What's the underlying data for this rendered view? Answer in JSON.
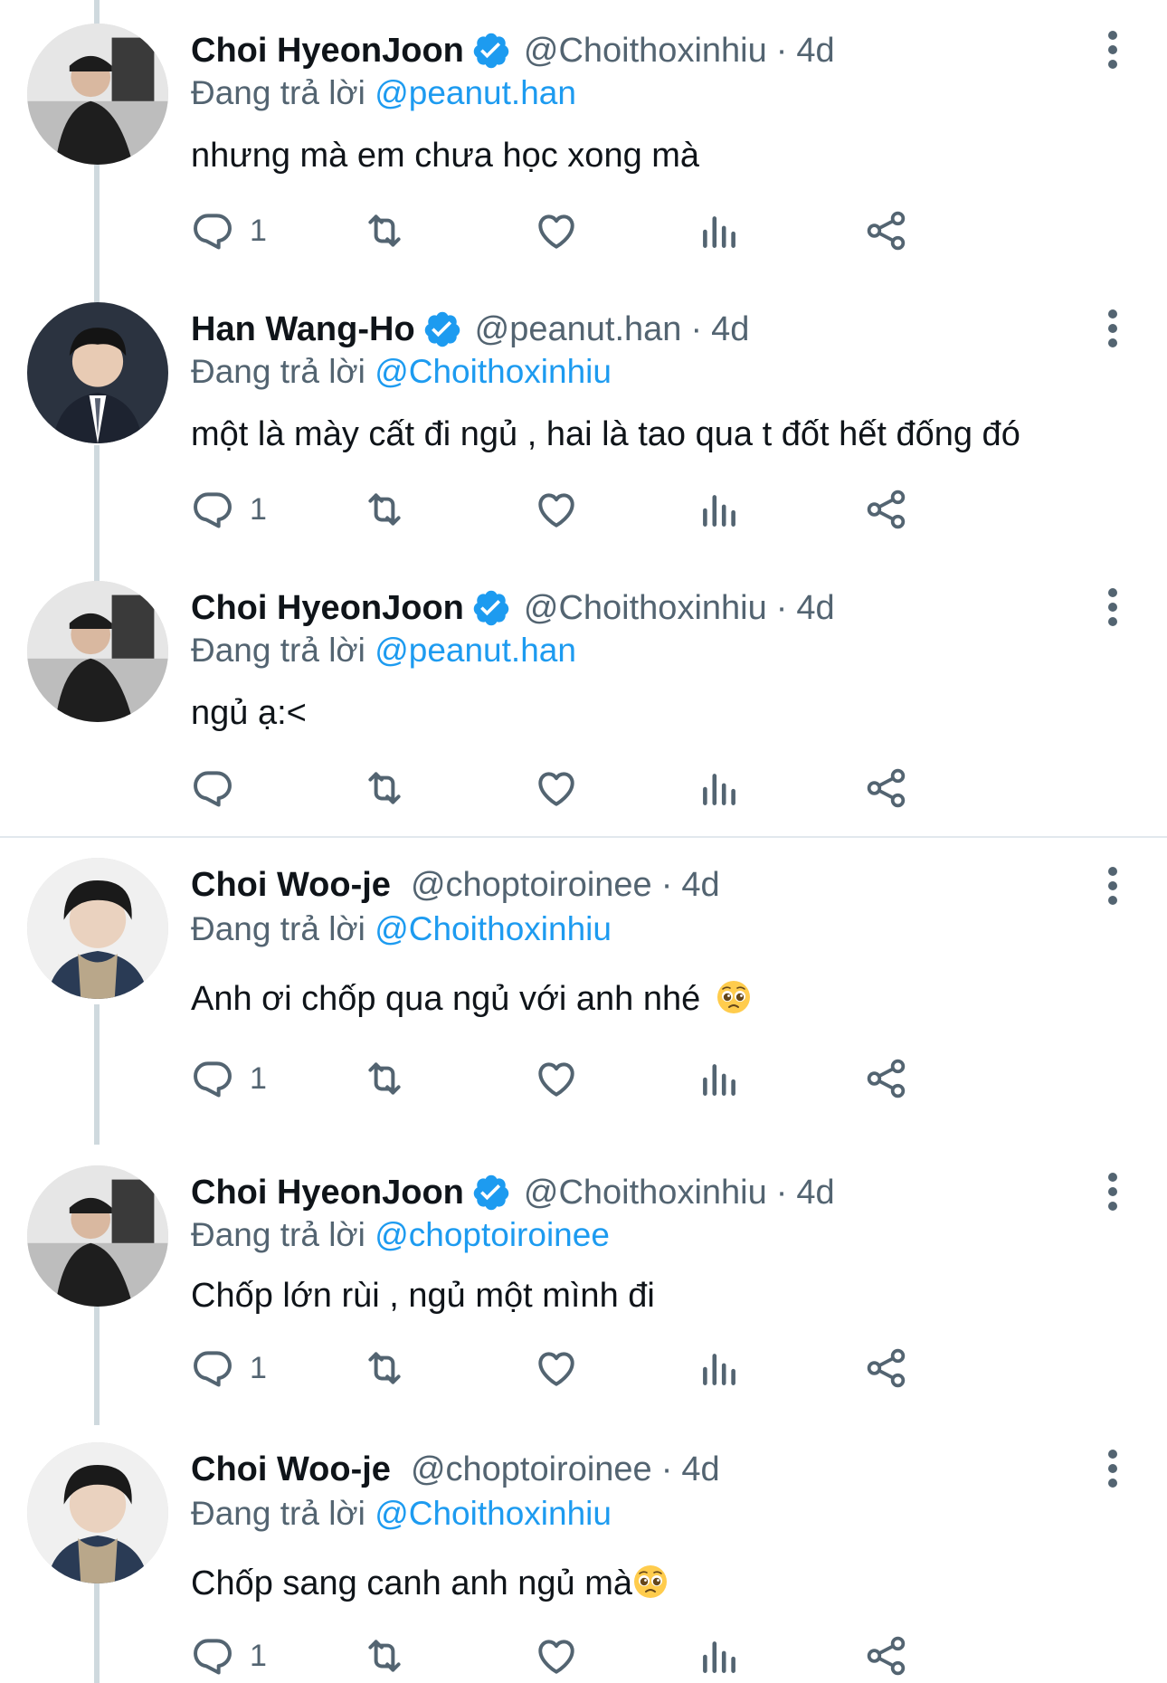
{
  "colors": {
    "accent": "#1d9bf0",
    "secondary_text": "#536471",
    "thread_line": "#cfd9de"
  },
  "reply_prefix": "Đang trả lời",
  "icons": {
    "reply": "reply-icon",
    "retweet": "retweet-icon",
    "like": "heart-icon",
    "views": "views-icon",
    "share": "share-icon",
    "more": "more-options-icon",
    "verified": "verified-badge-icon"
  },
  "tweets": [
    {
      "name": "Choi HyeonJoon",
      "verified": true,
      "handle": "@Choithoxinhiu",
      "time": "4d",
      "reply_to": "@peanut.han",
      "text": "nhưng mà em chưa học xong mà",
      "reply_count": "1",
      "avatar": "avatar-choi-hyeonjoon"
    },
    {
      "name": "Han Wang-Ho",
      "verified": true,
      "handle": "@peanut.han",
      "time": "4d",
      "reply_to": "@Choithoxinhiu",
      "text": "một là mày cất đi ngủ , hai là tao qua t đốt hết đống đó",
      "reply_count": "1",
      "avatar": "avatar-han-wang-ho"
    },
    {
      "name": "Choi HyeonJoon",
      "verified": true,
      "handle": "@Choithoxinhiu",
      "time": "4d",
      "reply_to": "@peanut.han",
      "text": "ngủ ạ:<",
      "reply_count": "",
      "avatar": "avatar-choi-hyeonjoon"
    },
    {
      "name": "Choi Woo-je",
      "verified": false,
      "handle": "@choptoiroinee",
      "time": "4d",
      "reply_to": "@Choithoxinhiu",
      "text": "Anh ơi chốp qua ngủ với anh nhé",
      "emoji": "pleading-face-emoji",
      "reply_count": "1",
      "avatar": "avatar-choi-woo-je"
    },
    {
      "name": "Choi HyeonJoon",
      "verified": true,
      "handle": "@Choithoxinhiu",
      "time": "4d",
      "reply_to": "@choptoiroinee",
      "text": "Chốp lớn rùi , ngủ một mình đi",
      "reply_count": "1",
      "avatar": "avatar-choi-hyeonjoon"
    },
    {
      "name": "Choi Woo-je",
      "verified": false,
      "handle": "@choptoiroinee",
      "time": "4d",
      "reply_to": "@Choithoxinhiu",
      "text": "Chốp sang canh anh ngủ mà",
      "emoji": "pleading-face-emoji",
      "reply_count": "1",
      "avatar": "avatar-choi-woo-je"
    }
  ]
}
